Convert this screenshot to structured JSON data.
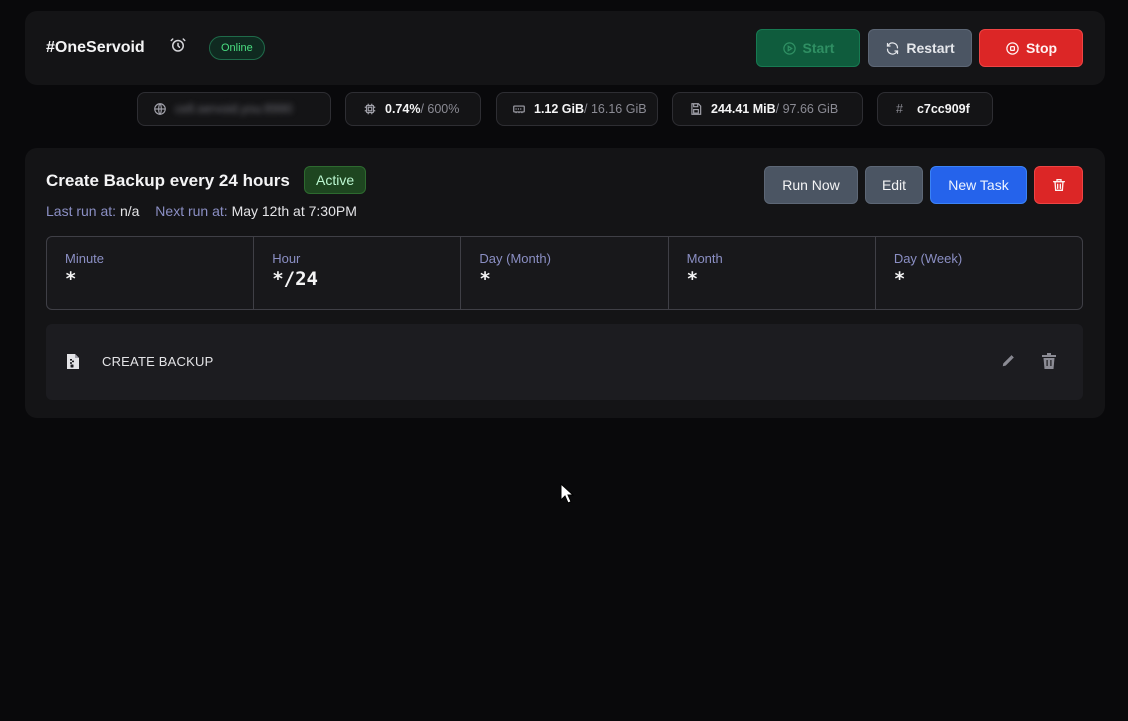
{
  "server": {
    "name": "#OneServoid",
    "status": "Online",
    "icons": {
      "alarm": "alarm-clock-icon"
    }
  },
  "power": {
    "start_label": "Start",
    "restart_label": "Restart",
    "stop_label": "Stop",
    "colors": {
      "start": "#0f5c3d",
      "restart": "#4b5563",
      "stop": "#dc2626"
    }
  },
  "stats": {
    "address": "cell.servoid.you:8990",
    "cpu": {
      "value": "0.74%",
      "limit": "/ 600%"
    },
    "memory": {
      "value": "1.12 GiB",
      "limit": "/ 16.16 GiB"
    },
    "disk": {
      "value": "244.41 MiB",
      "limit": "/ 97.66 GiB"
    },
    "id": {
      "symbol": "#",
      "value": "c7cc909f"
    }
  },
  "schedule": {
    "title": "Create Backup every 24 hours",
    "badge": "Active",
    "last_run_label": "Last run at:",
    "last_run_value": "n/a",
    "next_run_label": "Next run at:",
    "next_run_value": "May 12th at 7:30PM",
    "buttons": {
      "run_now": "Run Now",
      "edit": "Edit",
      "new_task": "New Task",
      "delete_icon": "trash-icon"
    },
    "cron": [
      {
        "label": "Minute",
        "value": "*"
      },
      {
        "label": "Hour",
        "value": "*/24"
      },
      {
        "label": "Day (Month)",
        "value": "*"
      },
      {
        "label": "Month",
        "value": "*"
      },
      {
        "label": "Day (Week)",
        "value": "*"
      }
    ],
    "tasks": [
      {
        "label": "CREATE BACKUP",
        "icon": "file-archive-icon"
      }
    ]
  },
  "colors": {
    "background": "#09090b",
    "card": "#141416",
    "accent_blue": "#2563eb",
    "muted_label": "#8b8fc4"
  }
}
